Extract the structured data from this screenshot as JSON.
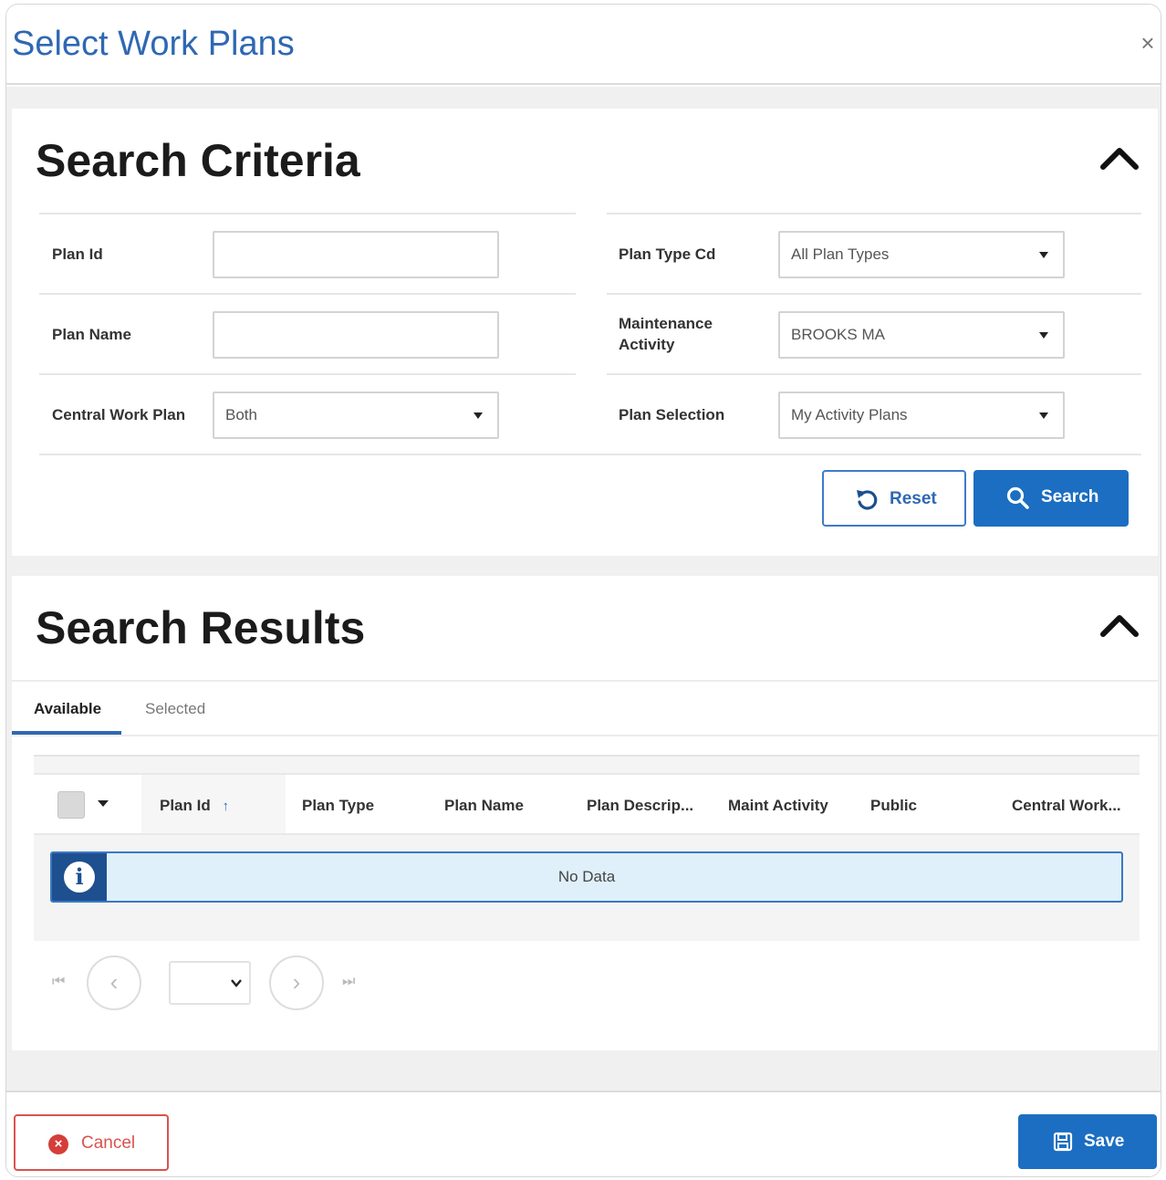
{
  "modal": {
    "title": "Select Work Plans",
    "close_label": "×"
  },
  "criteria": {
    "title": "Search Criteria",
    "fields": {
      "plan_id": {
        "label": "Plan Id",
        "value": ""
      },
      "plan_name": {
        "label": "Plan Name",
        "value": ""
      },
      "central_work_plan": {
        "label": "Central Work Plan",
        "value": "Both"
      },
      "plan_type_cd": {
        "label": "Plan Type Cd",
        "value": "All Plan Types"
      },
      "maintenance_activity": {
        "label_line1": "Maintenance",
        "label_line2": "Activity",
        "value": "BROOKS MA"
      },
      "plan_selection": {
        "label": "Plan Selection",
        "value": "My Activity Plans"
      }
    },
    "reset_label": "Reset",
    "search_label": "Search"
  },
  "results": {
    "title": "Search Results",
    "tabs": [
      {
        "label": "Available",
        "active": true
      },
      {
        "label": "Selected",
        "active": false
      }
    ],
    "columns": [
      "Plan Id",
      "Plan Type",
      "Plan Name",
      "Plan Descrip...",
      "Maint Activity",
      "Public",
      "Central Work..."
    ],
    "sort_indicator": "↑",
    "no_data": "No Data",
    "pager": {
      "first": "⏮",
      "prev": "‹",
      "next": "›",
      "last": "⏭",
      "page_value": ""
    }
  },
  "footer": {
    "cancel_label": "Cancel",
    "save_label": "Save"
  },
  "colors": {
    "title_blue": "#2f68b3",
    "primary": "#1b6ec2",
    "danger": "#d43f3a",
    "info_bg": "#dff0fa"
  }
}
